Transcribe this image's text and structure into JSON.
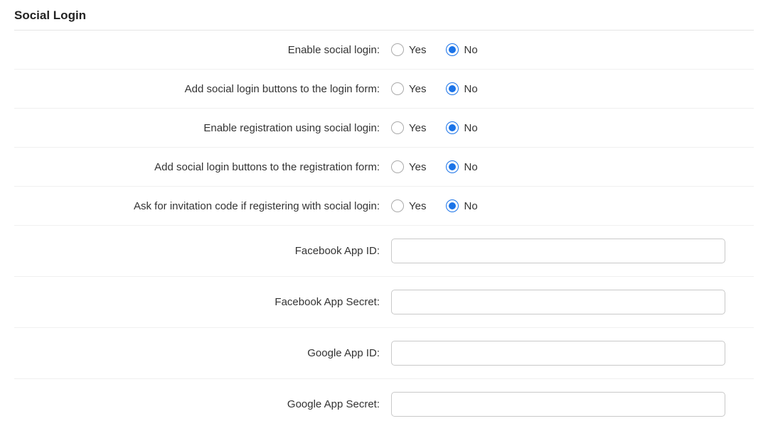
{
  "section_title": "Social Login",
  "options": {
    "yes": "Yes",
    "no": "No"
  },
  "rows": {
    "enable_social_login": {
      "label": "Enable social login:",
      "selected": "no"
    },
    "add_buttons_login_form": {
      "label": "Add social login buttons to the login form:",
      "selected": "no"
    },
    "enable_registration_social": {
      "label": "Enable registration using social login:",
      "selected": "no"
    },
    "add_buttons_registration_form": {
      "label": "Add social login buttons to the registration form:",
      "selected": "no"
    },
    "ask_invitation_code": {
      "label": "Ask for invitation code if registering with social login:",
      "selected": "no"
    },
    "facebook_app_id": {
      "label": "Facebook App ID:",
      "value": ""
    },
    "facebook_app_secret": {
      "label": "Facebook App Secret:",
      "value": ""
    },
    "google_app_id": {
      "label": "Google App ID:",
      "value": ""
    },
    "google_app_secret": {
      "label": "Google App Secret:",
      "value": ""
    }
  }
}
